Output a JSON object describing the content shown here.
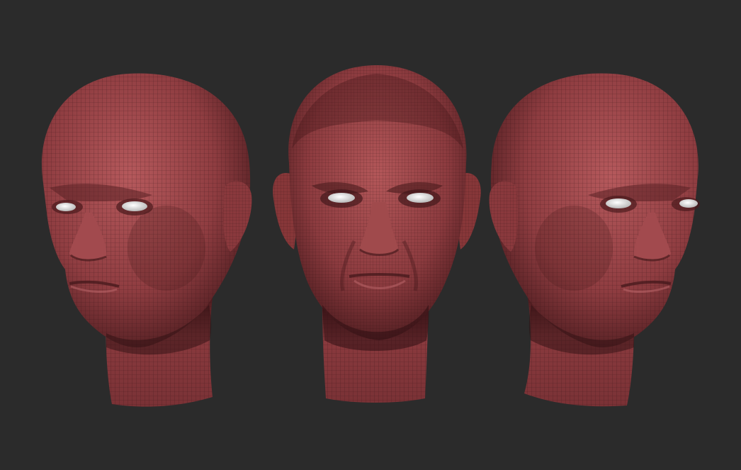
{
  "scene": {
    "background_color": "#2b2b2b",
    "subject": "three-views-of-3d-head-mesh",
    "mesh_color": "#9e4a4e",
    "mesh_shadow_color": "#3e1518",
    "mesh_highlight_color": "#c77a7c",
    "wire_color": "#2a0d10",
    "eye_color": "#e8e8e8",
    "views": [
      {
        "name": "three-quarter-left-view"
      },
      {
        "name": "front-view"
      },
      {
        "name": "three-quarter-right-view"
      }
    ]
  }
}
